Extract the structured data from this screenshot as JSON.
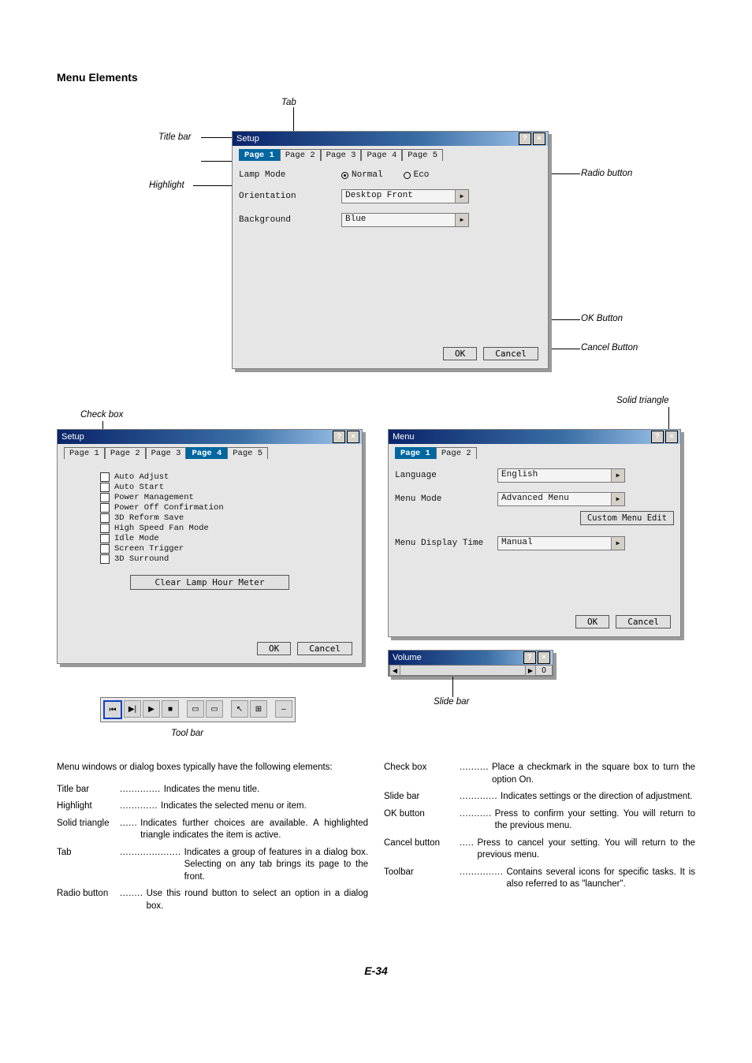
{
  "section_title": "Menu Elements",
  "labels": {
    "title_bar": "Title bar",
    "highlight": "Highlight",
    "tab": "Tab",
    "radio_button": "Radio button",
    "ok_button": "OK Button",
    "cancel_button": "Cancel Button",
    "check_box": "Check box",
    "solid_triangle": "Solid triangle",
    "tool_bar": "Tool bar",
    "slide_bar": "Slide bar"
  },
  "win1": {
    "title": "Setup",
    "tabs": [
      "Page 1",
      "Page 2",
      "Page 3",
      "Page 4",
      "Page 5"
    ],
    "active_tab": 0,
    "rows": {
      "lamp_mode": "Lamp Mode",
      "orientation": "Orientation",
      "background": "Background",
      "normal": "Normal",
      "eco": "Eco",
      "desktop_front": "Desktop Front",
      "blue": "Blue"
    },
    "ok": "OK",
    "cancel": "Cancel"
  },
  "win2": {
    "title": "Setup",
    "tabs": [
      "Page 1",
      "Page 2",
      "Page 3",
      "Page 4",
      "Page 5"
    ],
    "active_tab": 3,
    "checks": [
      "Auto Adjust",
      "Auto Start",
      "Power Management",
      "Power Off Confirmation",
      "3D Reform Save",
      "High Speed Fan Mode",
      "Idle Mode",
      "Screen Trigger",
      "3D Surround"
    ],
    "clear_btn": "Clear Lamp Hour Meter",
    "ok": "OK",
    "cancel": "Cancel"
  },
  "win3": {
    "title": "Menu",
    "tabs": [
      "Page 1",
      "Page 2"
    ],
    "active_tab": 0,
    "rows": {
      "language": "Language",
      "language_val": "English",
      "menu_mode": "Menu Mode",
      "menu_mode_val": "Advanced Menu",
      "custom_btn": "Custom Menu Edit",
      "display_time": "Menu Display Time",
      "display_time_val": "Manual"
    },
    "ok": "OK",
    "cancel": "Cancel"
  },
  "win4": {
    "title": "Volume",
    "value": "0"
  },
  "defs_intro": "Menu windows or dialog boxes typically have the following elements:",
  "defs_left": [
    {
      "term": "Title bar",
      "dots": " .............. ",
      "desc": "Indicates the menu title."
    },
    {
      "term": "Highlight",
      "dots": " ............. ",
      "desc": "Indicates the selected menu or item."
    },
    {
      "term": "Solid triangle",
      "dots": " ...... ",
      "desc": "Indicates further choices are available. A highlighted triangle indicates the item is active."
    },
    {
      "term": "Tab",
      "dots": " ..................... ",
      "desc": "Indicates a group of features in a dialog box. Selecting on any tab brings its page to the front."
    },
    {
      "term": "Radio button",
      "dots": " ........ ",
      "desc": "Use this round button to select an option in a dialog box."
    }
  ],
  "defs_right": [
    {
      "term": "Check box",
      "dots": " .......... ",
      "desc": "Place a checkmark in the square box to turn the option On."
    },
    {
      "term": "Slide bar",
      "dots": " ............. ",
      "desc": "Indicates settings or the direction of adjustment."
    },
    {
      "term": "OK button",
      "dots": " ........... ",
      "desc": "Press to confirm your setting. You will return to the previous menu."
    },
    {
      "term": "Cancel button",
      "dots": " ..... ",
      "desc": "Press to cancel your setting. You will return to the previous menu."
    },
    {
      "term": "Toolbar",
      "dots": " ............... ",
      "desc": "Contains several icons for specific tasks. It is also referred to as \"launcher\"."
    }
  ],
  "page_number": "E-34"
}
